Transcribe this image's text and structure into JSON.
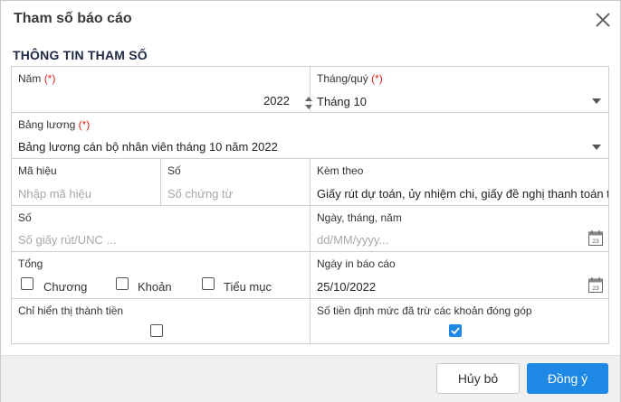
{
  "dialog": {
    "title": "Tham số báo cáo",
    "section_title": "THÔNG TIN THAM SỐ"
  },
  "fields": {
    "nam": {
      "label": "Năm",
      "required": "(*)",
      "value": "2022"
    },
    "thang_quy": {
      "label": "Tháng/quý",
      "required": "(*)",
      "value": "Tháng 10"
    },
    "bang_luong": {
      "label": "Bảng lương",
      "required": "(*)",
      "value": "Bảng lương cán bộ nhân viên tháng 10 năm 2022"
    },
    "ma_hieu": {
      "label": "Mã hiệu",
      "placeholder": "Nhập mã hiệu"
    },
    "so_chung_tu": {
      "label": "Số",
      "placeholder": "Số chứng từ"
    },
    "kem_theo": {
      "label": "Kèm theo",
      "value": "Giấy rút dự toán, ủy nhiệm chi, giấy đề nghị thanh toán tạm ứng"
    },
    "so_giay_rut": {
      "label": "Số",
      "placeholder": "Số giấy rút/UNC ..."
    },
    "ngay_thang_nam": {
      "label": "Ngày, tháng, năm",
      "placeholder": "dd/MM/yyyy..."
    },
    "tong": {
      "label": "Tổng",
      "options": [
        "Chương",
        "Khoản",
        "Tiểu mục"
      ],
      "checked": [
        false,
        false,
        false
      ]
    },
    "ngay_in": {
      "label": "Ngày in báo cáo",
      "value": "25/10/2022"
    },
    "chi_hien_thi": {
      "label": "Chỉ hiển thị thành tiền",
      "checked": false
    },
    "so_tien_dinh_muc": {
      "label": "Số tiền định mức đã trừ các khoản đóng góp",
      "checked": true
    }
  },
  "calendar_icon_text": "23",
  "buttons": {
    "cancel": "Hủy bỏ",
    "ok": "Đồng ý"
  },
  "colors": {
    "accent": "#1e88e5",
    "required": "#e02020"
  }
}
